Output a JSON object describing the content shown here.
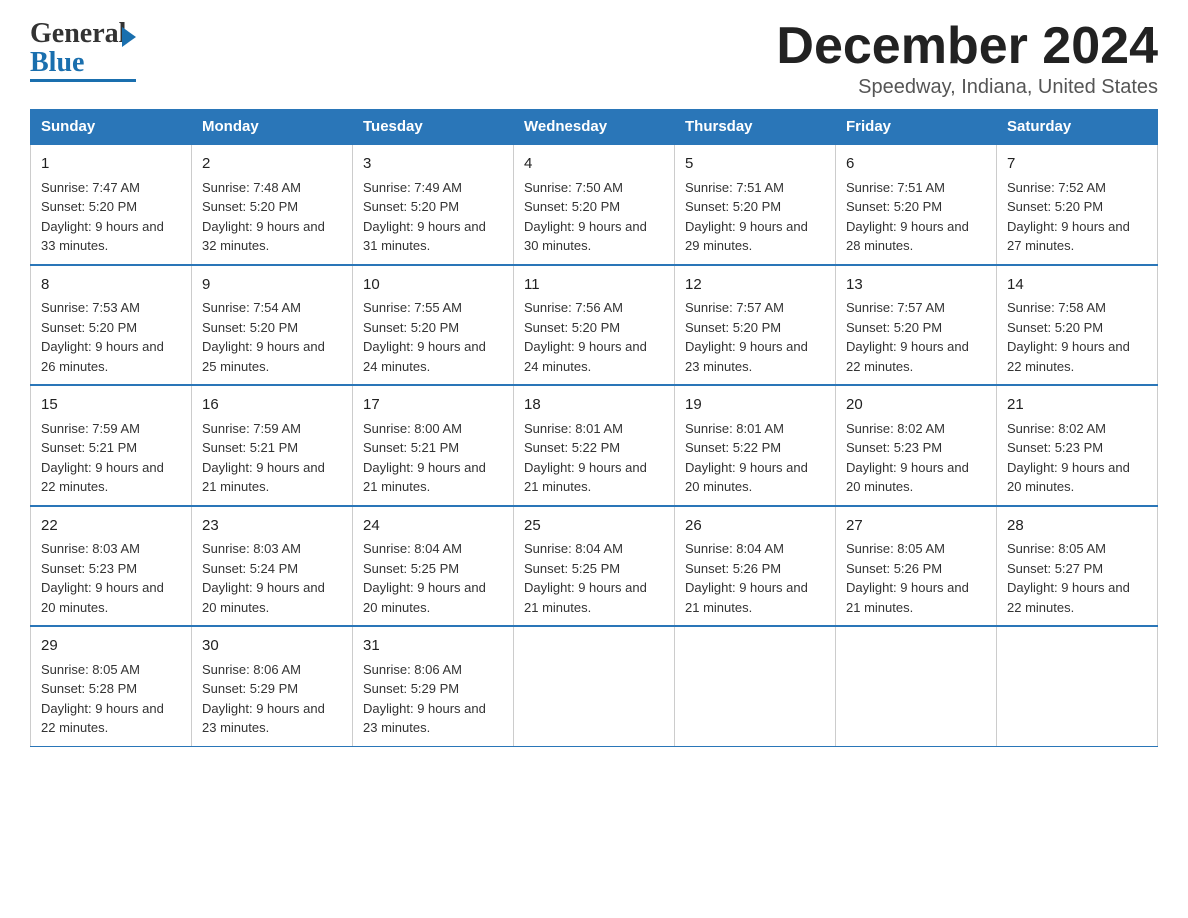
{
  "header": {
    "logo_line1": "General",
    "logo_line2": "Blue",
    "month": "December 2024",
    "location": "Speedway, Indiana, United States"
  },
  "weekdays": [
    "Sunday",
    "Monday",
    "Tuesday",
    "Wednesday",
    "Thursday",
    "Friday",
    "Saturday"
  ],
  "weeks": [
    [
      {
        "day": "1",
        "sunrise": "7:47 AM",
        "sunset": "5:20 PM",
        "daylight": "9 hours and 33 minutes."
      },
      {
        "day": "2",
        "sunrise": "7:48 AM",
        "sunset": "5:20 PM",
        "daylight": "9 hours and 32 minutes."
      },
      {
        "day": "3",
        "sunrise": "7:49 AM",
        "sunset": "5:20 PM",
        "daylight": "9 hours and 31 minutes."
      },
      {
        "day": "4",
        "sunrise": "7:50 AM",
        "sunset": "5:20 PM",
        "daylight": "9 hours and 30 minutes."
      },
      {
        "day": "5",
        "sunrise": "7:51 AM",
        "sunset": "5:20 PM",
        "daylight": "9 hours and 29 minutes."
      },
      {
        "day": "6",
        "sunrise": "7:51 AM",
        "sunset": "5:20 PM",
        "daylight": "9 hours and 28 minutes."
      },
      {
        "day": "7",
        "sunrise": "7:52 AM",
        "sunset": "5:20 PM",
        "daylight": "9 hours and 27 minutes."
      }
    ],
    [
      {
        "day": "8",
        "sunrise": "7:53 AM",
        "sunset": "5:20 PM",
        "daylight": "9 hours and 26 minutes."
      },
      {
        "day": "9",
        "sunrise": "7:54 AM",
        "sunset": "5:20 PM",
        "daylight": "9 hours and 25 minutes."
      },
      {
        "day": "10",
        "sunrise": "7:55 AM",
        "sunset": "5:20 PM",
        "daylight": "9 hours and 24 minutes."
      },
      {
        "day": "11",
        "sunrise": "7:56 AM",
        "sunset": "5:20 PM",
        "daylight": "9 hours and 24 minutes."
      },
      {
        "day": "12",
        "sunrise": "7:57 AM",
        "sunset": "5:20 PM",
        "daylight": "9 hours and 23 minutes."
      },
      {
        "day": "13",
        "sunrise": "7:57 AM",
        "sunset": "5:20 PM",
        "daylight": "9 hours and 22 minutes."
      },
      {
        "day": "14",
        "sunrise": "7:58 AM",
        "sunset": "5:20 PM",
        "daylight": "9 hours and 22 minutes."
      }
    ],
    [
      {
        "day": "15",
        "sunrise": "7:59 AM",
        "sunset": "5:21 PM",
        "daylight": "9 hours and 22 minutes."
      },
      {
        "day": "16",
        "sunrise": "7:59 AM",
        "sunset": "5:21 PM",
        "daylight": "9 hours and 21 minutes."
      },
      {
        "day": "17",
        "sunrise": "8:00 AM",
        "sunset": "5:21 PM",
        "daylight": "9 hours and 21 minutes."
      },
      {
        "day": "18",
        "sunrise": "8:01 AM",
        "sunset": "5:22 PM",
        "daylight": "9 hours and 21 minutes."
      },
      {
        "day": "19",
        "sunrise": "8:01 AM",
        "sunset": "5:22 PM",
        "daylight": "9 hours and 20 minutes."
      },
      {
        "day": "20",
        "sunrise": "8:02 AM",
        "sunset": "5:23 PM",
        "daylight": "9 hours and 20 minutes."
      },
      {
        "day": "21",
        "sunrise": "8:02 AM",
        "sunset": "5:23 PM",
        "daylight": "9 hours and 20 minutes."
      }
    ],
    [
      {
        "day": "22",
        "sunrise": "8:03 AM",
        "sunset": "5:23 PM",
        "daylight": "9 hours and 20 minutes."
      },
      {
        "day": "23",
        "sunrise": "8:03 AM",
        "sunset": "5:24 PM",
        "daylight": "9 hours and 20 minutes."
      },
      {
        "day": "24",
        "sunrise": "8:04 AM",
        "sunset": "5:25 PM",
        "daylight": "9 hours and 20 minutes."
      },
      {
        "day": "25",
        "sunrise": "8:04 AM",
        "sunset": "5:25 PM",
        "daylight": "9 hours and 21 minutes."
      },
      {
        "day": "26",
        "sunrise": "8:04 AM",
        "sunset": "5:26 PM",
        "daylight": "9 hours and 21 minutes."
      },
      {
        "day": "27",
        "sunrise": "8:05 AM",
        "sunset": "5:26 PM",
        "daylight": "9 hours and 21 minutes."
      },
      {
        "day": "28",
        "sunrise": "8:05 AM",
        "sunset": "5:27 PM",
        "daylight": "9 hours and 22 minutes."
      }
    ],
    [
      {
        "day": "29",
        "sunrise": "8:05 AM",
        "sunset": "5:28 PM",
        "daylight": "9 hours and 22 minutes."
      },
      {
        "day": "30",
        "sunrise": "8:06 AM",
        "sunset": "5:29 PM",
        "daylight": "9 hours and 23 minutes."
      },
      {
        "day": "31",
        "sunrise": "8:06 AM",
        "sunset": "5:29 PM",
        "daylight": "9 hours and 23 minutes."
      },
      null,
      null,
      null,
      null
    ]
  ]
}
